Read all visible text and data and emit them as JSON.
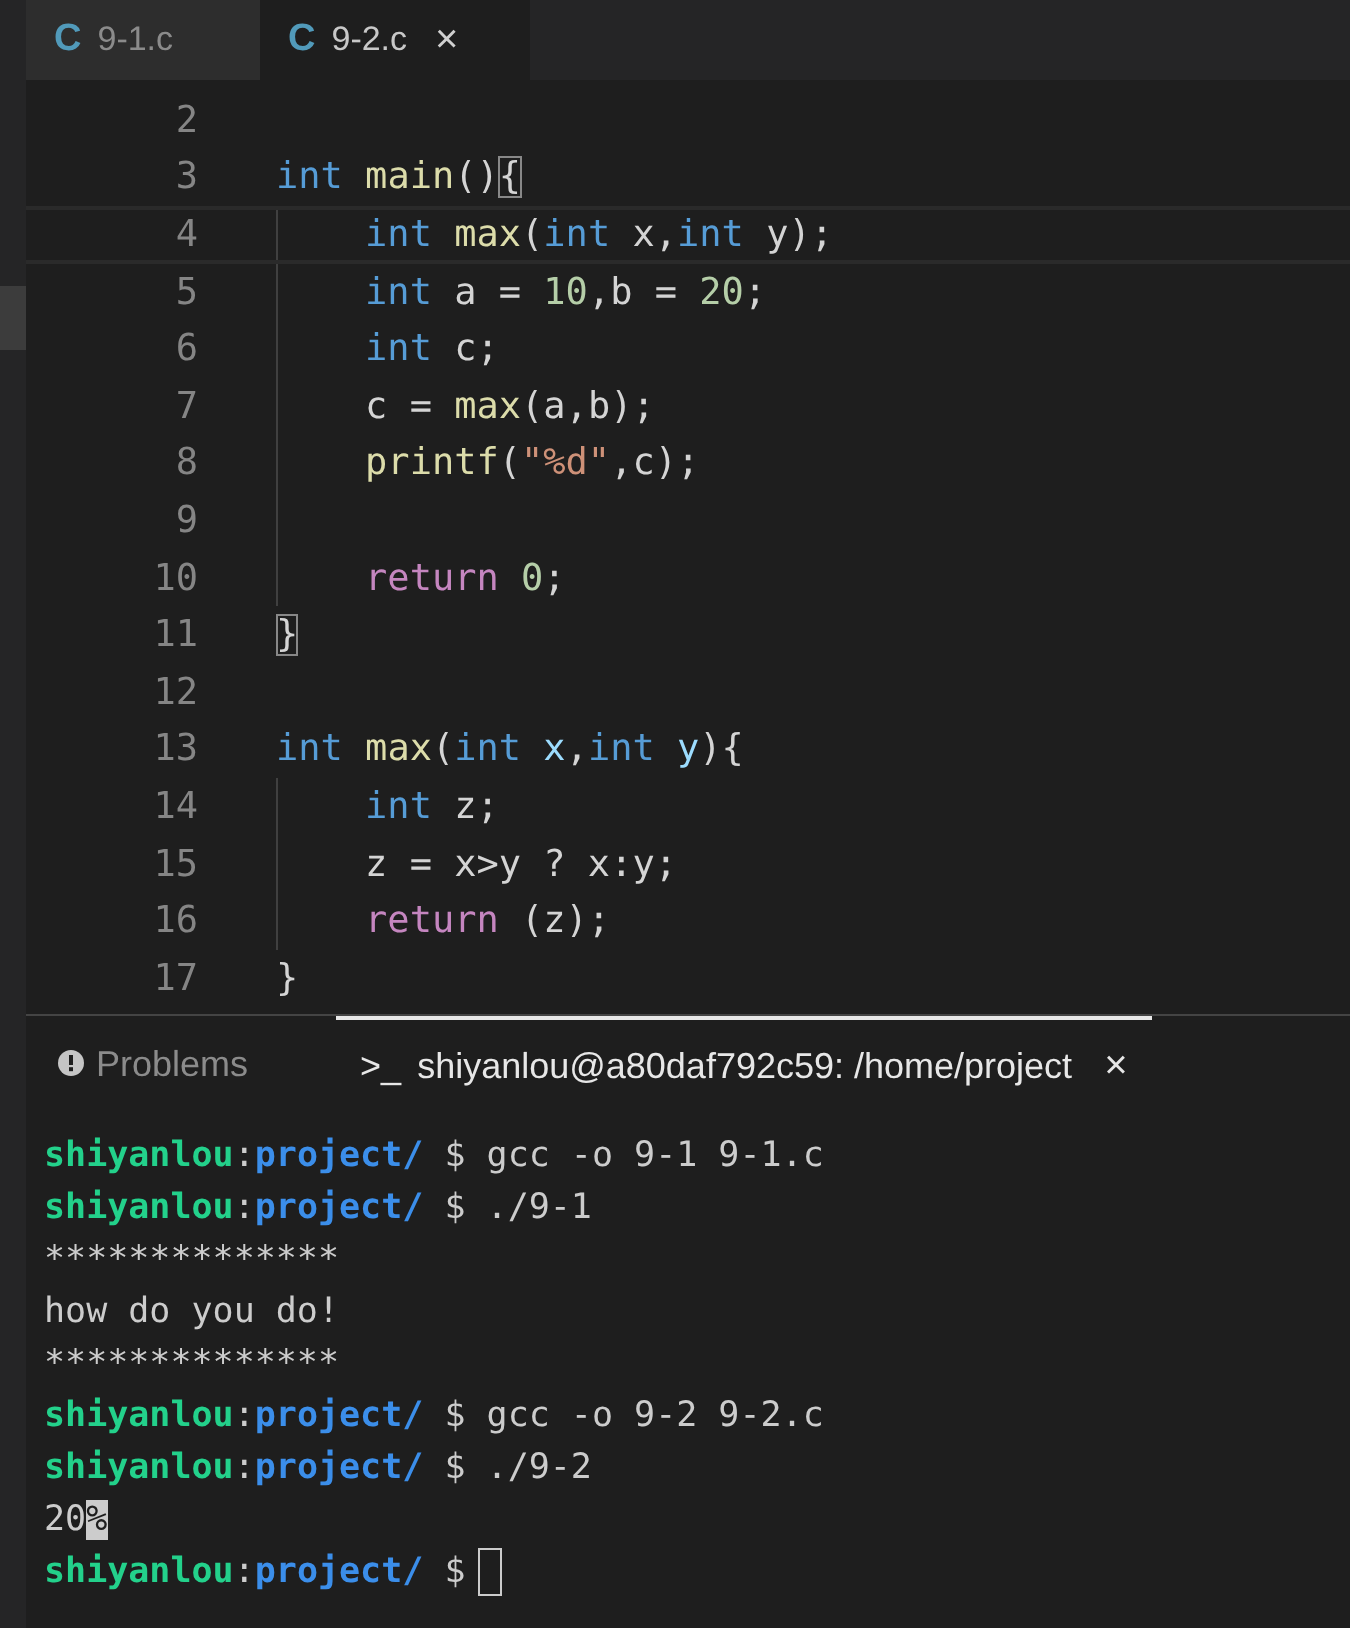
{
  "tabs": [
    {
      "label": "9-1.c",
      "icon": "C",
      "selected": false
    },
    {
      "label": "9-2.c",
      "icon": "C",
      "selected": true,
      "close": "×"
    }
  ],
  "editor": {
    "lines": [
      {
        "number": "2",
        "current": false,
        "indent": false
      },
      {
        "number": "3",
        "current": false,
        "indent": false,
        "tokens": [
          {
            "kind": "keyword",
            "text": "int"
          },
          {
            "kind": "function",
            "text": " main"
          },
          {
            "kind": "plain",
            "text": "()"
          },
          {
            "kind": "bracket",
            "text": "{"
          }
        ]
      },
      {
        "number": "4",
        "current": true,
        "indent": true,
        "tokens": [
          {
            "kind": "keyword",
            "text": "int"
          },
          {
            "kind": "function",
            "text": " max"
          },
          {
            "kind": "plain",
            "text": "("
          },
          {
            "kind": "keyword",
            "text": "int"
          },
          {
            "kind": "plain",
            "text": " x,"
          },
          {
            "kind": "keyword",
            "text": "int"
          },
          {
            "kind": "plain",
            "text": " y);"
          }
        ]
      },
      {
        "number": "5",
        "current": false,
        "indent": true,
        "tokens": [
          {
            "kind": "keyword",
            "text": "int"
          },
          {
            "kind": "plain",
            "text": " a = "
          },
          {
            "kind": "number",
            "text": "10"
          },
          {
            "kind": "plain",
            "text": ",b = "
          },
          {
            "kind": "number",
            "text": "20"
          },
          {
            "kind": "plain",
            "text": ";"
          }
        ]
      },
      {
        "number": "6",
        "current": false,
        "indent": true,
        "tokens": [
          {
            "kind": "keyword",
            "text": "int"
          },
          {
            "kind": "plain",
            "text": " c;"
          }
        ]
      },
      {
        "number": "7",
        "current": false,
        "indent": true,
        "tokens": [
          {
            "kind": "plain",
            "text": "c = "
          },
          {
            "kind": "function",
            "text": "max"
          },
          {
            "kind": "plain",
            "text": "(a,b);"
          }
        ]
      },
      {
        "number": "8",
        "current": false,
        "indent": true,
        "tokens": [
          {
            "kind": "function",
            "text": "printf"
          },
          {
            "kind": "plain",
            "text": "("
          },
          {
            "kind": "string",
            "text": "\"%d\""
          },
          {
            "kind": "plain",
            "text": ",c);"
          }
        ]
      },
      {
        "number": "9",
        "current": false,
        "indent": true
      },
      {
        "number": "10",
        "current": false,
        "indent": true,
        "tokens": [
          {
            "kind": "control",
            "text": "return"
          },
          {
            "kind": "number",
            "text": " 0"
          },
          {
            "kind": "plain",
            "text": ";"
          }
        ]
      },
      {
        "number": "11",
        "current": false,
        "indent": false,
        "tokens": [
          {
            "kind": "bracket",
            "text": "}"
          }
        ]
      },
      {
        "number": "12",
        "current": false,
        "indent": false
      },
      {
        "number": "13",
        "current": false,
        "indent": false,
        "tokens": [
          {
            "kind": "keyword",
            "text": "int"
          },
          {
            "kind": "function",
            "text": " max"
          },
          {
            "kind": "plain",
            "text": "("
          },
          {
            "kind": "keyword",
            "text": "int"
          },
          {
            "kind": "param",
            "text": " x"
          },
          {
            "kind": "plain",
            "text": ","
          },
          {
            "kind": "keyword",
            "text": "int"
          },
          {
            "kind": "param",
            "text": " y"
          },
          {
            "kind": "plain",
            "text": "){"
          }
        ]
      },
      {
        "number": "14",
        "current": false,
        "indent": true,
        "tokens": [
          {
            "kind": "keyword",
            "text": "int"
          },
          {
            "kind": "plain",
            "text": " z;"
          }
        ]
      },
      {
        "number": "15",
        "current": false,
        "indent": true,
        "tokens": [
          {
            "kind": "plain",
            "text": "z = x>y ? x:y;"
          }
        ]
      },
      {
        "number": "16",
        "current": false,
        "indent": true,
        "tokens": [
          {
            "kind": "control",
            "text": "return"
          },
          {
            "kind": "plain",
            "text": " (z);"
          }
        ]
      },
      {
        "number": "17",
        "current": false,
        "indent": false,
        "tokens": [
          {
            "kind": "plain",
            "text": "}"
          }
        ]
      }
    ]
  },
  "panel": {
    "tabs": [
      {
        "label": "Problems",
        "kind": "problems",
        "selected": false
      },
      {
        "label": "shiyanlou@a80daf792c59: /home/project",
        "prefix": ">_",
        "kind": "terminal",
        "selected": true,
        "close": "×"
      }
    ],
    "terminal": [
      {
        "cursor": false,
        "segments": [
          {
            "kind": "user",
            "text": "shiyanlou"
          },
          {
            "kind": "plain",
            "text": ":"
          },
          {
            "kind": "path",
            "text": "project/"
          },
          {
            "kind": "plain",
            "text": " $ gcc -o 9-1 9-1.c"
          }
        ]
      },
      {
        "cursor": false,
        "segments": [
          {
            "kind": "user",
            "text": "shiyanlou"
          },
          {
            "kind": "plain",
            "text": ":"
          },
          {
            "kind": "path",
            "text": "project/"
          },
          {
            "kind": "plain",
            "text": " $ ./9-1"
          }
        ]
      },
      {
        "cursor": false,
        "segments": [
          {
            "kind": "plain",
            "text": "**************"
          }
        ]
      },
      {
        "cursor": false,
        "segments": [
          {
            "kind": "plain",
            "text": "how do you do!"
          }
        ]
      },
      {
        "cursor": false,
        "segments": [
          {
            "kind": "plain",
            "text": "**************"
          }
        ]
      },
      {
        "cursor": false,
        "segments": [
          {
            "kind": "user",
            "text": "shiyanlou"
          },
          {
            "kind": "plain",
            "text": ":"
          },
          {
            "kind": "path",
            "text": "project/"
          },
          {
            "kind": "plain",
            "text": " $ gcc -o 9-2 9-2.c"
          }
        ]
      },
      {
        "cursor": false,
        "segments": [
          {
            "kind": "user",
            "text": "shiyanlou"
          },
          {
            "kind": "plain",
            "text": ":"
          },
          {
            "kind": "path",
            "text": "project/"
          },
          {
            "kind": "plain",
            "text": " $ ./9-2"
          }
        ]
      },
      {
        "cursor": false,
        "segments": [
          {
            "kind": "plain",
            "text": "20"
          },
          {
            "kind": "inverse",
            "text": "%"
          }
        ]
      },
      {
        "cursor": true,
        "segments": [
          {
            "kind": "user",
            "text": "shiyanlou"
          },
          {
            "kind": "plain",
            "text": ":"
          },
          {
            "kind": "path",
            "text": "project/"
          },
          {
            "kind": "plain",
            "text": " $"
          }
        ]
      }
    ]
  }
}
